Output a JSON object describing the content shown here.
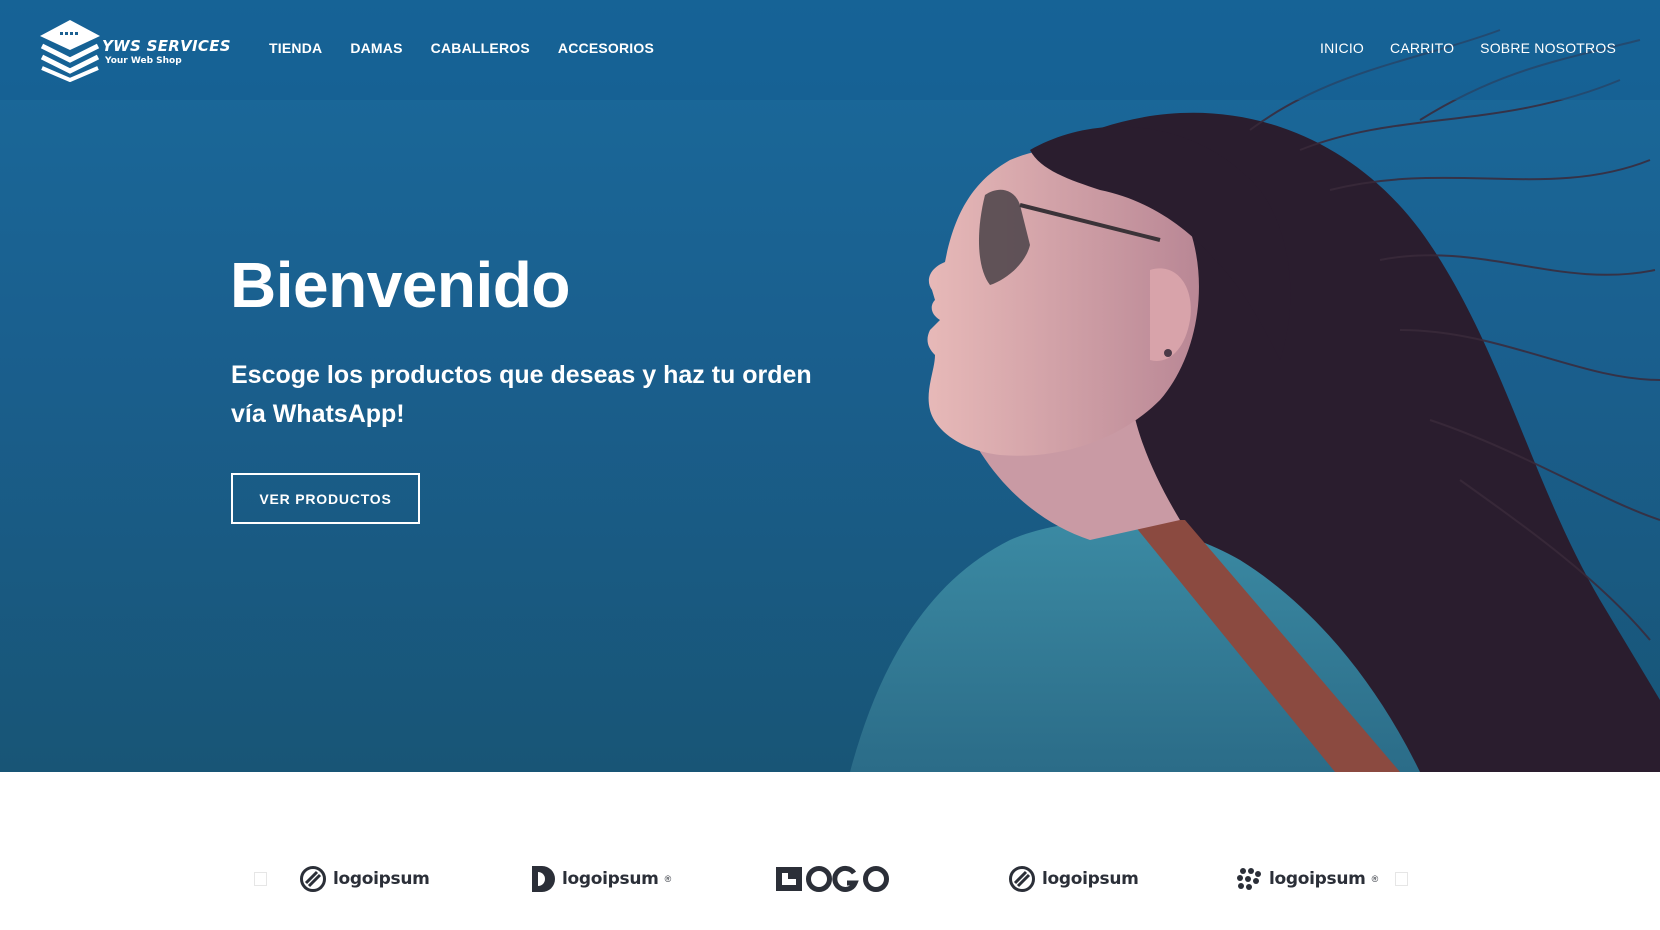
{
  "brand": {
    "title": "YWS SERVICES",
    "subtitle": "Your Web Shop"
  },
  "nav": {
    "left": [
      "TIENDA",
      "DAMAS",
      "CABALLEROS",
      "ACCESORIOS"
    ],
    "right": [
      "INICIO",
      "CARRITO",
      "SOBRE NOSOTROS"
    ]
  },
  "hero": {
    "title": "Bienvenido",
    "subtitle": "Escoge los productos que deseas y haz tu orden vía WhatsApp!",
    "button": "VER PRODUCTOS"
  },
  "partner_logos": [
    {
      "text": "logoipsum",
      "mark": "logoipsum"
    },
    {
      "text": "logoipsum",
      "mark": "logoipsum",
      "superscript": "®"
    },
    {
      "text": "LOGO",
      "mark": "LOGO",
      "icon": "logo-wordmark-icon"
    },
    {
      "text": "logoipsum",
      "mark": "logoipsum"
    },
    {
      "text": "logoipsum",
      "mark": "logoipsum",
      "superscript": "®"
    }
  ],
  "colors": {
    "hero_top": "#1a6a9c",
    "hero_bottom": "#185576",
    "logo_text": "#2b2f38"
  }
}
